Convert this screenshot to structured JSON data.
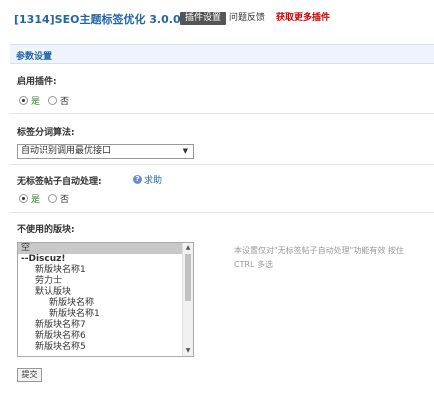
{
  "header": {
    "title": "[1314]SEO主题标签优化 3.0.0",
    "tabs": [
      "插件设置",
      "问题反馈",
      "获取更多插件"
    ]
  },
  "section": {
    "title": "参数设置"
  },
  "enable_plugin": {
    "label": "启用插件:",
    "options": [
      "是",
      "否"
    ],
    "selected": "是"
  },
  "segmentation": {
    "label": "标签分词算法:",
    "value": "自动识别调用最优接口"
  },
  "no_tag_auto": {
    "label": "无标签帖子自动处理:",
    "help": "求助",
    "options": [
      "是",
      "否"
    ],
    "selected": "是"
  },
  "unused_forums": {
    "label": "不使用的版块:",
    "items": [
      {
        "text": "空",
        "indent": 0,
        "selected": true,
        "group": false
      },
      {
        "text": "--Discuz!",
        "indent": 0,
        "selected": false,
        "group": true
      },
      {
        "text": "新版块名称1",
        "indent": 1,
        "selected": false,
        "group": false
      },
      {
        "text": "劳力士",
        "indent": 1,
        "selected": false,
        "group": false
      },
      {
        "text": "默认版块",
        "indent": 1,
        "selected": false,
        "group": false
      },
      {
        "text": "新版块名称",
        "indent": 2,
        "selected": false,
        "group": false
      },
      {
        "text": "新版块名称1",
        "indent": 2,
        "selected": false,
        "group": false
      },
      {
        "text": "新版块名称7",
        "indent": 1,
        "selected": false,
        "group": false
      },
      {
        "text": "新版块名称6",
        "indent": 1,
        "selected": false,
        "group": false
      },
      {
        "text": "新版块名称5",
        "indent": 1,
        "selected": false,
        "group": false
      }
    ],
    "note": "本设置仅对\"无标签帖子自动处理\"功能有效 按住 CTRL 多选"
  },
  "submit_label": "提交"
}
